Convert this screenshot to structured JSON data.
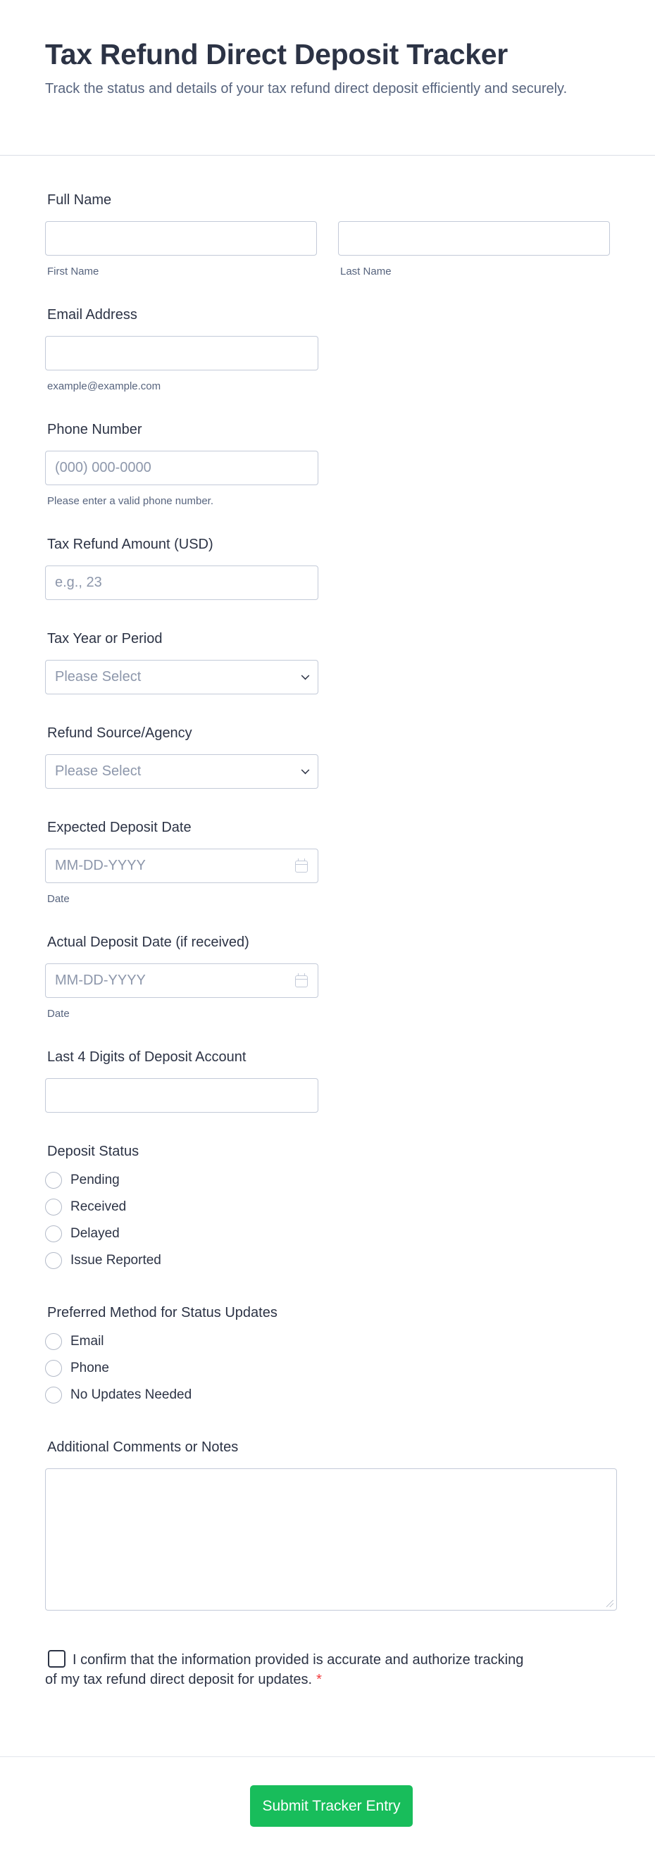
{
  "header": {
    "title": "Tax Refund Direct Deposit Tracker",
    "subtitle": "Track the status and details of your tax refund direct deposit efficiently and securely."
  },
  "fields": {
    "full_name": {
      "label": "Full Name",
      "first_sublabel": "First Name",
      "last_sublabel": "Last Name"
    },
    "email": {
      "label": "Email Address",
      "sublabel": "example@example.com"
    },
    "phone": {
      "label": "Phone Number",
      "placeholder": "(000) 000-0000",
      "sublabel": "Please enter a valid phone number."
    },
    "refund_amount": {
      "label": "Tax Refund Amount (USD)",
      "placeholder": "e.g., 23"
    },
    "tax_year": {
      "label": "Tax Year or Period",
      "selected": "Please Select"
    },
    "refund_source": {
      "label": "Refund Source/Agency",
      "selected": "Please Select"
    },
    "expected_date": {
      "label": "Expected Deposit Date",
      "placeholder": "MM-DD-YYYY",
      "sublabel": "Date"
    },
    "actual_date": {
      "label": "Actual Deposit Date (if received)",
      "placeholder": "MM-DD-YYYY",
      "sublabel": "Date"
    },
    "last4": {
      "label": "Last 4 Digits of Deposit Account"
    },
    "deposit_status": {
      "label": "Deposit Status",
      "options": [
        "Pending",
        "Received",
        "Delayed",
        "Issue Reported"
      ]
    },
    "update_method": {
      "label": "Preferred Method for Status Updates",
      "options": [
        "Email",
        "Phone",
        "No Updates Needed"
      ]
    },
    "comments": {
      "label": "Additional Comments or Notes"
    },
    "confirm": {
      "text": "I confirm that the information provided is accurate and authorize tracking of my tax refund direct deposit for updates.",
      "required_mark": "*"
    }
  },
  "footer": {
    "submit_label": "Submit Tracker Entry"
  },
  "colors": {
    "accent": "#18bd5b",
    "required": "#f23a3c",
    "text": "#2c3345",
    "muted": "#57647e"
  }
}
